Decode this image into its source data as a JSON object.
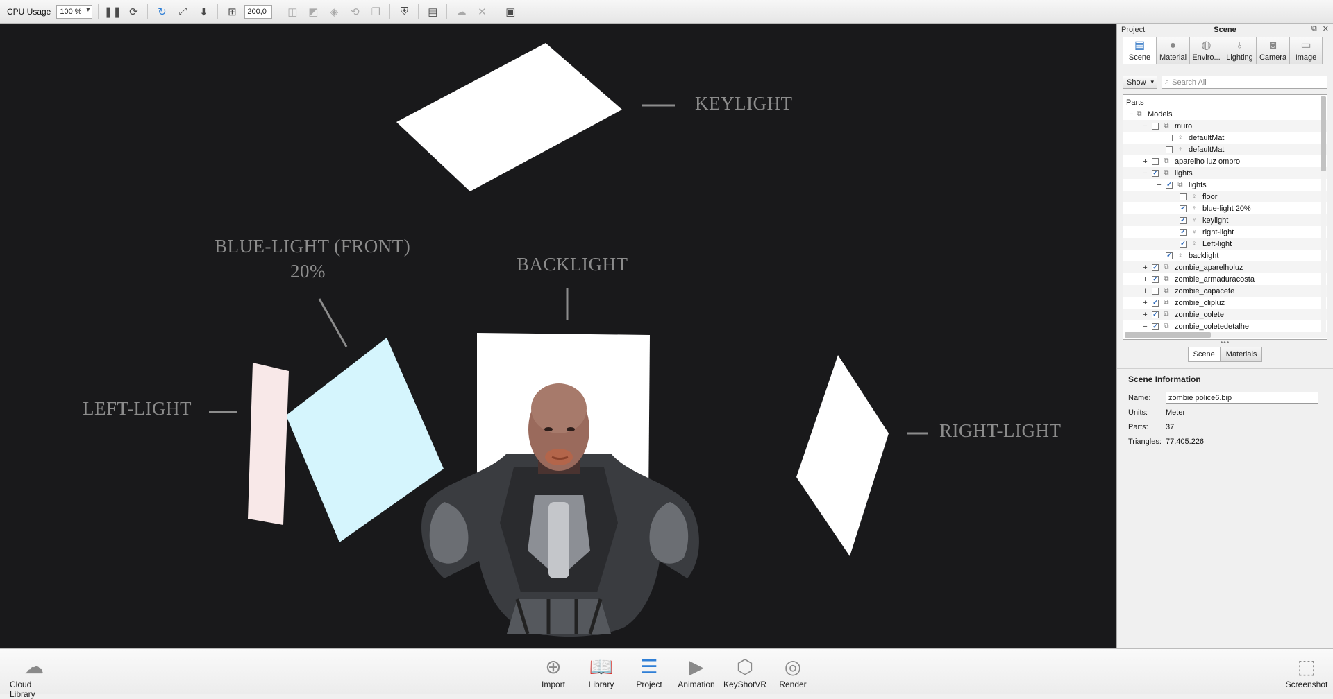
{
  "toolbar": {
    "cpu_label": "CPU Usage",
    "cpu_value": "100 %",
    "resolution_value": "200,0",
    "icons": [
      "pause-icon",
      "sync-icon",
      "refresh-icon",
      "fit-icon",
      "down-arrow-icon",
      "region-icon",
      "camera-icon",
      "camera2-icon",
      "screenshot-icon",
      "rotate-icon",
      "copy-icon",
      "shield-icon",
      "panel-icon",
      "cloud-icon",
      "expand-icon",
      "console-icon"
    ]
  },
  "viewport": {
    "labels": {
      "keylight": "KEYLIGHT",
      "blue_light": "BLUE-LIGHT (FRONT)",
      "blue_light_pct": "20%",
      "backlight": "BACKLIGHT",
      "left_light": "LEFT-LIGHT",
      "right_light": "RIGHT-LIGHT"
    },
    "colors": {
      "background": "#19191b",
      "blue_panel": "#d5f5fd",
      "pink_panel": "#f8e8e8",
      "label": "#8c8c8c"
    }
  },
  "panel": {
    "project_label": "Project",
    "title": "Scene",
    "tabs": [
      {
        "label": "Scene",
        "icon": "scene-icon",
        "active": true
      },
      {
        "label": "Material",
        "icon": "material-icon",
        "active": false
      },
      {
        "label": "Enviro...",
        "icon": "environment-icon",
        "active": false
      },
      {
        "label": "Lighting",
        "icon": "lighting-icon",
        "active": false
      },
      {
        "label": "Camera",
        "icon": "camera-icon",
        "active": false
      },
      {
        "label": "Image",
        "icon": "image-icon",
        "active": false
      }
    ],
    "show_label": "Show",
    "search_placeholder": "Search All",
    "parts_label": "Parts",
    "tree": [
      {
        "label": "Models",
        "level": 0,
        "expander": "−",
        "checkbox": null
      },
      {
        "label": "muro",
        "level": 1,
        "expander": "−",
        "checkbox": false
      },
      {
        "label": "defaultMat",
        "level": 2,
        "expander": "",
        "checkbox": false
      },
      {
        "label": "defaultMat",
        "level": 2,
        "expander": "",
        "checkbox": false
      },
      {
        "label": "aparelho luz ombro",
        "level": 1,
        "expander": "+",
        "checkbox": false
      },
      {
        "label": "lights",
        "level": 1,
        "expander": "−",
        "checkbox": true
      },
      {
        "label": "lights",
        "level": 2,
        "expander": "−",
        "checkbox": true
      },
      {
        "label": "floor",
        "level": 3,
        "expander": "",
        "checkbox": false
      },
      {
        "label": "blue-light 20%",
        "level": 3,
        "expander": "",
        "checkbox": true
      },
      {
        "label": "keylight",
        "level": 3,
        "expander": "",
        "checkbox": true
      },
      {
        "label": "right-light",
        "level": 3,
        "expander": "",
        "checkbox": true
      },
      {
        "label": "Left-light",
        "level": 3,
        "expander": "",
        "checkbox": true
      },
      {
        "label": "backlight",
        "level": 2,
        "expander": "",
        "checkbox": true
      },
      {
        "label": "zombie_aparelholuz",
        "level": 1,
        "expander": "+",
        "checkbox": true
      },
      {
        "label": "zombie_armaduracosta",
        "level": 1,
        "expander": "+",
        "checkbox": true
      },
      {
        "label": "zombie_capacete",
        "level": 1,
        "expander": "+",
        "checkbox": false
      },
      {
        "label": "zombie_clipluz",
        "level": 1,
        "expander": "+",
        "checkbox": true
      },
      {
        "label": "zombie_colete",
        "level": 1,
        "expander": "+",
        "checkbox": true
      },
      {
        "label": "zombie_coletedetalhe",
        "level": 1,
        "expander": "−",
        "checkbox": true
      }
    ],
    "subtabs": [
      "Scene",
      "Materials"
    ],
    "scene_info": {
      "heading": "Scene Information",
      "name_label": "Name:",
      "name_value": "zombie police6.bip",
      "units_label": "Units:",
      "units_value": "Meter",
      "parts_label": "Parts:",
      "parts_value": "37",
      "triangles_label": "Triangles:",
      "triangles_value": "77.405.226"
    }
  },
  "bottom": {
    "cloud_library": "Cloud Library",
    "import": "Import",
    "library": "Library",
    "project": "Project",
    "animation": "Animation",
    "keyshotvr": "KeyShotVR",
    "render": "Render",
    "screenshot": "Screenshot"
  }
}
